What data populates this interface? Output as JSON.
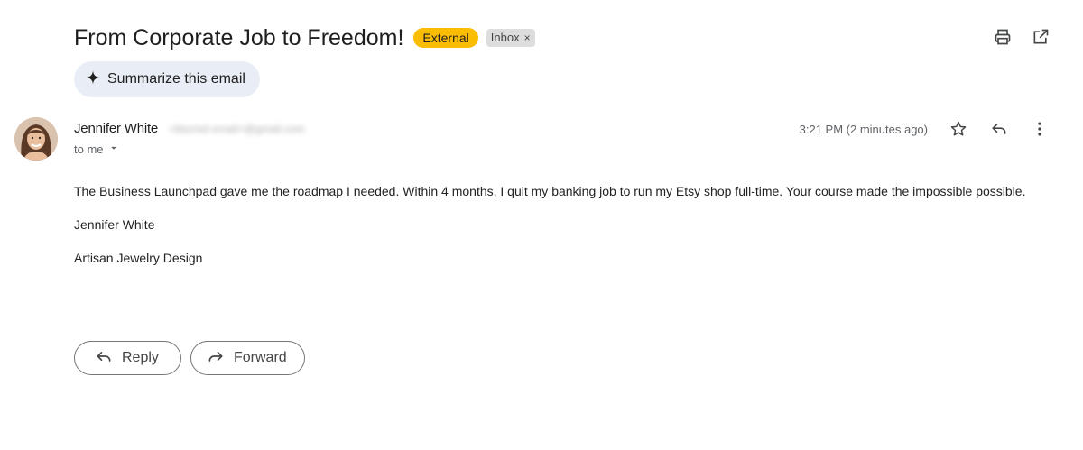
{
  "header": {
    "subject": "From Corporate Job to Freedom!",
    "external_badge": "External",
    "inbox_label": "Inbox",
    "inbox_remove": "×",
    "icons": [
      "print-icon",
      "open-in-new-window-icon"
    ]
  },
  "summarize": {
    "label": "Summarize this email",
    "icon": "sparkle-icon"
  },
  "message": {
    "sender_name": "Jennifer White",
    "sender_email": "<blurred email>@gmail.com",
    "recipient": "to me",
    "timestamp": "3:21 PM (2 minutes ago)",
    "icons": [
      "star-icon",
      "reply-icon",
      "more-vert-icon"
    ],
    "body_paragraph": "The Business Launchpad gave me the roadmap I needed. Within 4 months, I quit my banking job to run my Etsy shop full-time. Your course made the impossible possible.",
    "signature_name": "Jennifer White",
    "signature_company": "Artisan Jewelry Design"
  },
  "actions": {
    "reply_label": "Reply",
    "forward_label": "Forward"
  },
  "colors": {
    "external_badge_bg": "#fbbc04",
    "inbox_badge_bg": "#dddddd",
    "summarize_bg": "#e9eef6",
    "text_primary": "#1f1f1f",
    "text_secondary": "#5f6368"
  }
}
